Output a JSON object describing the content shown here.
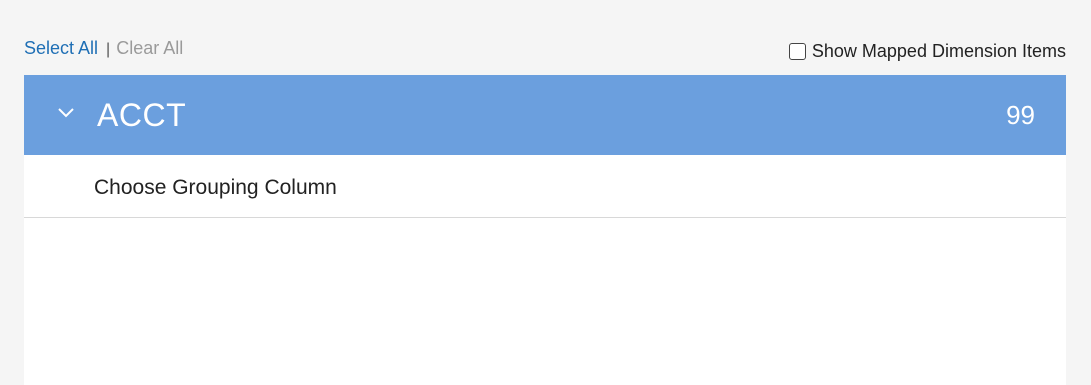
{
  "toolbar": {
    "select_all": "Select All",
    "separator": "|",
    "clear_all": "Clear All",
    "show_mapped_label": "Show Mapped Dimension Items",
    "show_mapped_checked": false
  },
  "group": {
    "title": "ACCT",
    "count": "99",
    "expanded": true,
    "chevron_icon": "chevron-down-icon",
    "header_color": "#6b9fde"
  },
  "rows": [
    {
      "label": "Choose Grouping Column"
    }
  ],
  "colors": {
    "link": "#1f6fb5",
    "disabled_link": "#9a9a9a",
    "background": "#f5f5f5"
  }
}
